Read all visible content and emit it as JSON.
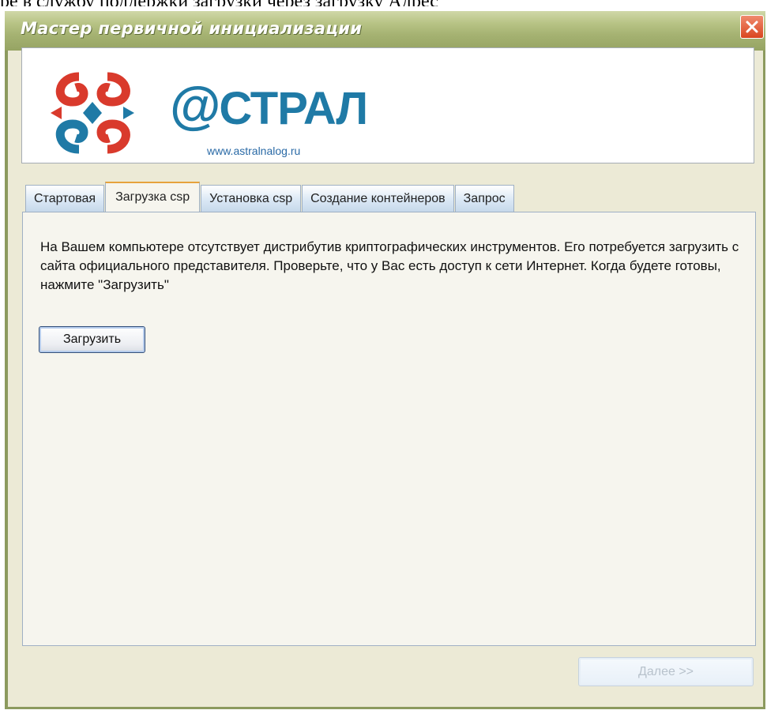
{
  "document_fragment": "ре в службу поддержки загрузки через загрузку Адрес",
  "window": {
    "title": "Мастер первичной инициализации",
    "close_icon": "close-icon"
  },
  "logo": {
    "name": "@СТРАЛ",
    "url": "www.astralnalog.ru",
    "colors": {
      "red": "#d93a2c",
      "blue": "#1f7aa6"
    }
  },
  "tabs": [
    {
      "label": "Стартовая",
      "active": false
    },
    {
      "label": "Загрузка csp",
      "active": true
    },
    {
      "label": "Установка csp",
      "active": false
    },
    {
      "label": "Создание контейнеров",
      "active": false
    },
    {
      "label": "Запрос",
      "active": false
    }
  ],
  "panel": {
    "message": "На Вашем компьютере отсутствует дистрибутив криптографических инструментов. Его потребуется загрузить с сайта официального представителя. Проверьте, что у Вас есть доступ к сети Интернет. Когда будете готовы, нажмите \"Загрузить\"",
    "download_button": "Загрузить"
  },
  "footer": {
    "next_button": "Далее >>",
    "next_enabled": false
  }
}
